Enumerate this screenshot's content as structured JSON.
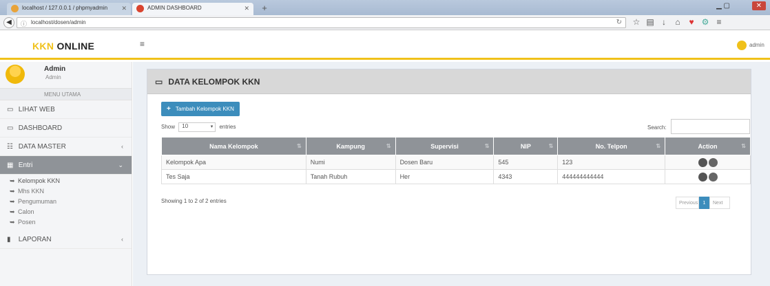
{
  "browser": {
    "tab1_title": "localhost / 127.0.0.1 / phpmyadmin",
    "tab2_title": "ADMIN DASHBOARD",
    "url": "localhost/dosen/admin"
  },
  "header": {
    "logo_kkn": "KKN",
    "logo_online": "ONLINE",
    "username": "admin"
  },
  "sidebar": {
    "user_name": "Admin",
    "user_role": "Admin",
    "menu_heading": "MENU UTAMA",
    "items": [
      {
        "label": "LIHAT WEB"
      },
      {
        "label": "DASHBOARD"
      },
      {
        "label": "DATA MASTER"
      },
      {
        "label": "Entri"
      },
      {
        "label": "LAPORAN"
      }
    ],
    "subitems": [
      {
        "label": "Kelompok KKN"
      },
      {
        "label": "Mhs KKN"
      },
      {
        "label": "Pengumuman"
      },
      {
        "label": "Calon"
      },
      {
        "label": "Posen"
      }
    ]
  },
  "box": {
    "title": "DATA KELOMPOK KKN",
    "add_button": "Tambah Kelompok KKN",
    "show_label": "Show",
    "show_value": "10",
    "entries_label": "entries",
    "search_label": "Search:",
    "columns": [
      "Nama Kelompok",
      "Kampung",
      "Supervisi",
      "NIP",
      "No. Telpon",
      "Action"
    ],
    "rows": [
      [
        "Kelompok Apa",
        "Numi",
        "Dosen Baru",
        "545",
        "123"
      ],
      [
        "Tes Saja",
        "Tanah Rubuh",
        "Her",
        "4343",
        "444444444444"
      ]
    ],
    "info": "Showing 1 to 2 of 2 entries",
    "pager": {
      "prev": "Previous",
      "page": "1",
      "next": "Next"
    }
  }
}
